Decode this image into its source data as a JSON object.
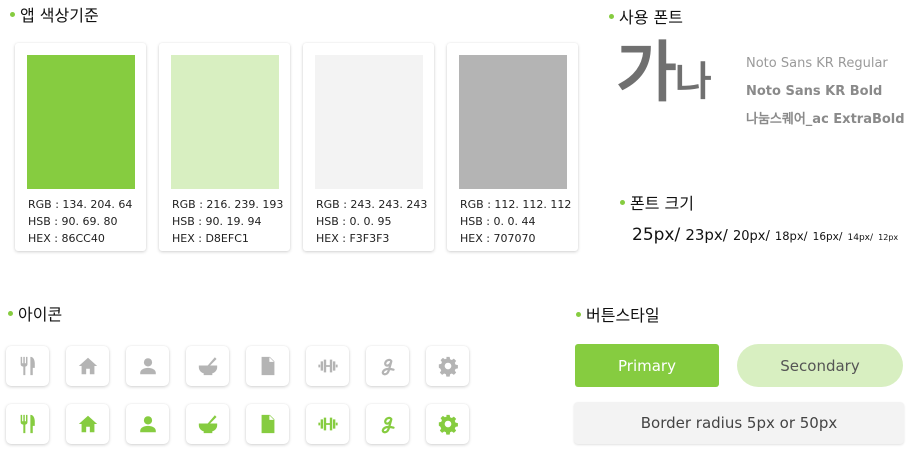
{
  "sections": {
    "colors": "앱 색상기준",
    "fonts": "사용 폰트",
    "font_size": "폰트 크기",
    "icons": "아이콘",
    "buttons": "버튼스타일"
  },
  "swatches": [
    {
      "color": "#86CC40",
      "rgb": "RGB : 134. 204. 64",
      "hsb": "HSB : 90. 69. 80",
      "hex": "HEX : 86CC40"
    },
    {
      "color": "#D8EFC1",
      "rgb": "RGB : 216. 239. 193",
      "hsb": "HSB : 90. 19. 94",
      "hex": "HEX : D8EFC1"
    },
    {
      "color": "#F3F3F3",
      "rgb": "RGB : 243. 243. 243",
      "hsb": "HSB : 0. 0. 95",
      "hex": "HEX : F3F3F3"
    },
    {
      "color": "#B4B4B4",
      "rgb": "RGB : 112. 112. 112",
      "hsb": "HSB : 0. 0. 44",
      "hex": "HEX : 707070"
    }
  ],
  "font_sample": {
    "ga": "가",
    "na": "나"
  },
  "font_names": [
    "Noto Sans KR Regular",
    "Noto Sans KR Bold",
    "나눔스퀘어_ac ExtraBold"
  ],
  "font_sizes": [
    "25px/",
    "23px/",
    "20px/",
    "18px/",
    "16px/",
    "14px/",
    "12px"
  ],
  "icons": [
    "fork-knife-icon",
    "home-icon",
    "user-icon",
    "mortar-pestle-icon",
    "document-icon",
    "dumbbell-icon",
    "cursive-g-icon",
    "gear-icon"
  ],
  "icon_colors": {
    "inactive": "#B4B4B4",
    "active": "#86CC40"
  },
  "buttons": {
    "primary": "Primary",
    "secondary": "Secondary",
    "border": "Border radius 5px or 50px"
  },
  "colors": {
    "accent": "#86CC40",
    "accent_light": "#D8EFC1",
    "neutral": "#F3F3F3",
    "gray": "#707070"
  }
}
